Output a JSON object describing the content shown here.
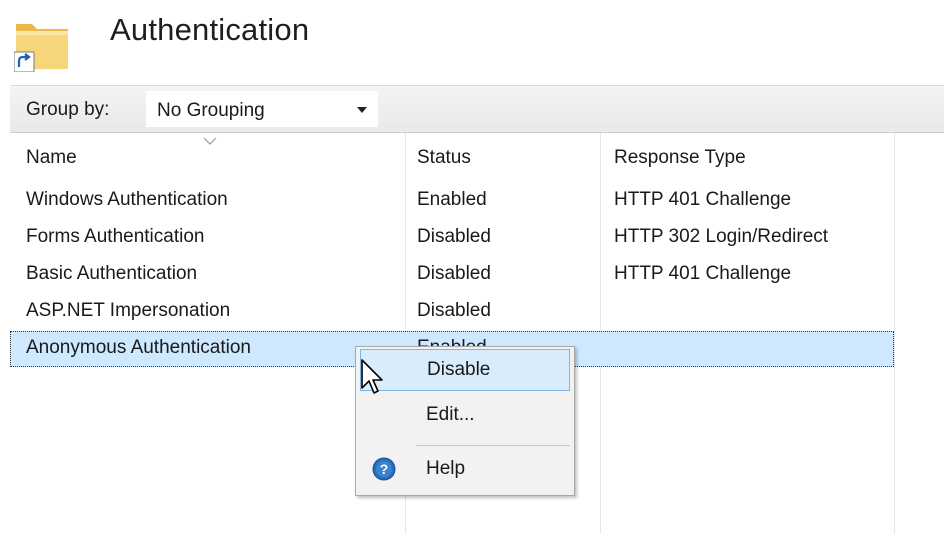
{
  "header": {
    "title": "Authentication",
    "icon": "folder-shortcut-icon"
  },
  "toolbar": {
    "groupby_label": "Group by:",
    "groupby_value": "No Grouping"
  },
  "columns": {
    "name": "Name",
    "status": "Status",
    "response_type": "Response Type"
  },
  "rows": [
    {
      "name": "Windows Authentication",
      "status": "Enabled",
      "response_type": "HTTP 401 Challenge"
    },
    {
      "name": "Forms Authentication",
      "status": "Disabled",
      "response_type": "HTTP 302 Login/Redirect"
    },
    {
      "name": "Basic Authentication",
      "status": "Disabled",
      "response_type": "HTTP 401 Challenge"
    },
    {
      "name": "ASP.NET Impersonation",
      "status": "Disabled",
      "response_type": ""
    },
    {
      "name": "Anonymous Authentication",
      "status": "Enabled",
      "response_type": ""
    }
  ],
  "context_menu": {
    "items": [
      {
        "label": "Disable",
        "highlighted": true
      },
      {
        "label": "Edit...",
        "highlighted": false
      },
      {
        "label": "Help",
        "icon": "help-icon"
      }
    ]
  },
  "colors": {
    "selection": "#cde8ff",
    "menu_highlight": "#d9ecfc",
    "help_blue": "#2a6ebb"
  }
}
